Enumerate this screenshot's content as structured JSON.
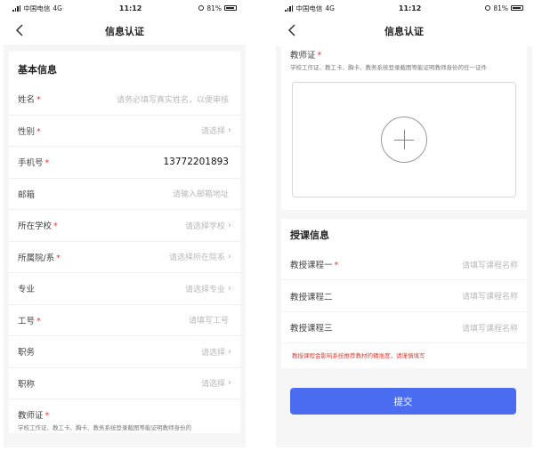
{
  "status_bar": {
    "carrier": "中国电信",
    "network": "4G",
    "time": "11:12",
    "battery": "81%"
  },
  "page_title": "信息认证",
  "basic": {
    "title": "基本信息",
    "fields": [
      {
        "label": "姓名",
        "required": "*",
        "value": "请务必填写真实姓名，以便审核",
        "chevron": ""
      },
      {
        "label": "性别",
        "required": "*",
        "value": "请选择",
        "chevron": "›"
      },
      {
        "label": "手机号",
        "required": "*",
        "value": "13772201893",
        "chevron": ""
      },
      {
        "label": "邮箱",
        "required": "",
        "value": "请输入邮箱地址",
        "chevron": ""
      },
      {
        "label": "所在学校",
        "required": "*",
        "value": "请选择学校",
        "chevron": "›"
      },
      {
        "label": "所属院/系",
        "required": "*",
        "value": "请选择所在院系",
        "chevron": "›"
      },
      {
        "label": "专业",
        "required": "",
        "value": "请选择专业",
        "chevron": "›"
      },
      {
        "label": "工号",
        "required": "*",
        "value": "请填写工号",
        "chevron": ""
      },
      {
        "label": "职务",
        "required": "",
        "value": "请选择",
        "chevron": "›"
      },
      {
        "label": "职称",
        "required": "",
        "value": "请选择",
        "chevron": "›"
      }
    ]
  },
  "certificate": {
    "label": "教师证",
    "required": "*",
    "desc_left": "学校工作证、教工卡、胸卡、教务系统登录截图等能证明教师身份的",
    "desc_right": "学校工作证、教工卡、胸卡、教务系统登录截图等能证明教师身份的任一证件"
  },
  "courses": {
    "title": "授课信息",
    "fields": [
      {
        "label": "教授课程一",
        "required": "*",
        "value": "请填写课程名称"
      },
      {
        "label": "教授课程二",
        "required": "",
        "value": "请填写课程名称"
      },
      {
        "label": "教授课程三",
        "required": "",
        "value": "请填写课程名称"
      }
    ],
    "note": "教授课程会影响系统推荐教材的精准度，请谨慎填写"
  },
  "submit_label": "提交",
  "colors": {
    "accent": "#4a6cf0",
    "required": "#e23b2e"
  }
}
